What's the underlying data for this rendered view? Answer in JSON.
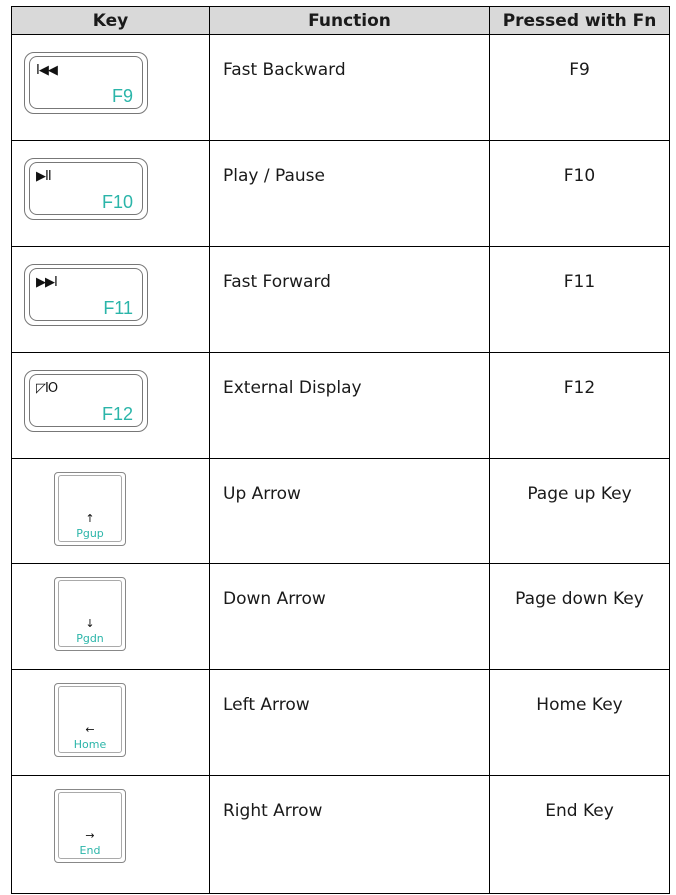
{
  "headers": {
    "key": "Key",
    "function": "Function",
    "fn": "Pressed with Fn"
  },
  "rows": [
    {
      "icon": "fast-backward-icon",
      "symbol": "I◀◀",
      "key_label": "F9",
      "function": "Fast Backward",
      "fn": "F9"
    },
    {
      "icon": "play-pause-icon",
      "symbol": "▶II",
      "key_label": "F10",
      "function": "Play / Pause",
      "fn": "F10"
    },
    {
      "icon": "fast-forward-icon",
      "symbol": "▶▶I",
      "key_label": "F11",
      "function": "Fast Forward",
      "fn": "F11"
    },
    {
      "icon": "external-display-icon",
      "symbol": "◸ⅠO",
      "key_label": "F12",
      "function": "External Display",
      "fn": "F12"
    },
    {
      "icon": "up-arrow-icon",
      "symbol": "↑",
      "key_label": "Pgup",
      "function": "Up Arrow",
      "fn": "Page up Key"
    },
    {
      "icon": "down-arrow-icon",
      "symbol": "↓",
      "key_label": "Pgdn",
      "function": "Down Arrow",
      "fn": "Page down Key"
    },
    {
      "icon": "left-arrow-icon",
      "symbol": "←",
      "key_label": "Home",
      "function": "Left Arrow",
      "fn": "Home Key"
    },
    {
      "icon": "right-arrow-icon",
      "symbol": "→",
      "key_label": "End",
      "function": "Right Arrow",
      "fn": "End Key"
    }
  ],
  "colors": {
    "header_bg": "#d9d9d9",
    "key_accent": "#2bb5a9",
    "border": "#000000"
  }
}
